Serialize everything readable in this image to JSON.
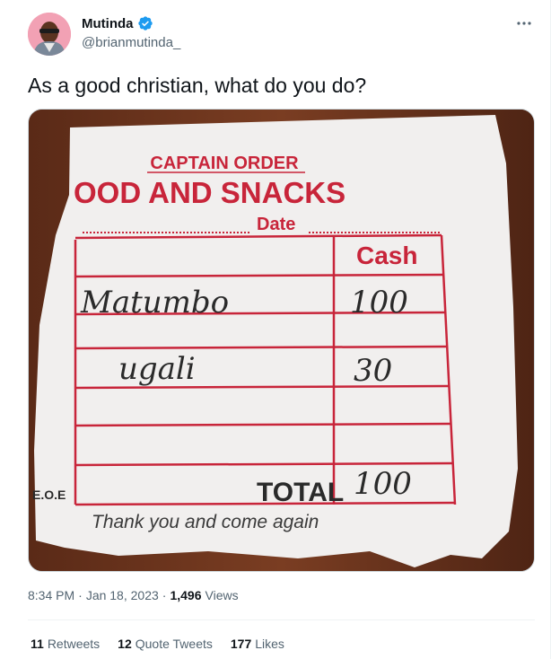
{
  "author": {
    "name": "Mutinda",
    "handle": "@brianmutinda_",
    "verified": true
  },
  "tweet": {
    "text": "As a good christian, what do you do?"
  },
  "receipt": {
    "header": "CAPTAIN ORDER",
    "title": "OOD AND SNACKS",
    "date_label": "Date",
    "cash_label": "Cash",
    "items": [
      {
        "name": "Matumbo",
        "amount": "100"
      },
      {
        "name": "ugali",
        "amount": "30"
      }
    ],
    "eoe": "E.O.E",
    "total_label": "TOTAL",
    "total_value": "100",
    "footer": "Thank you and come again"
  },
  "meta": {
    "time": "8:34 PM",
    "sep1": "·",
    "date": "Jan 18, 2023",
    "sep2": "·",
    "views_count": "1,496",
    "views_label": "Views"
  },
  "stats": {
    "retweets_count": "11",
    "retweets_label": "Retweets",
    "quotes_count": "12",
    "quotes_label": "Quote Tweets",
    "likes_count": "177",
    "likes_label": "Likes"
  },
  "colors": {
    "verified": "#1d9bf0",
    "secondary_text": "#536471",
    "receipt_red": "#c8253a",
    "wood": "#6a3520"
  }
}
